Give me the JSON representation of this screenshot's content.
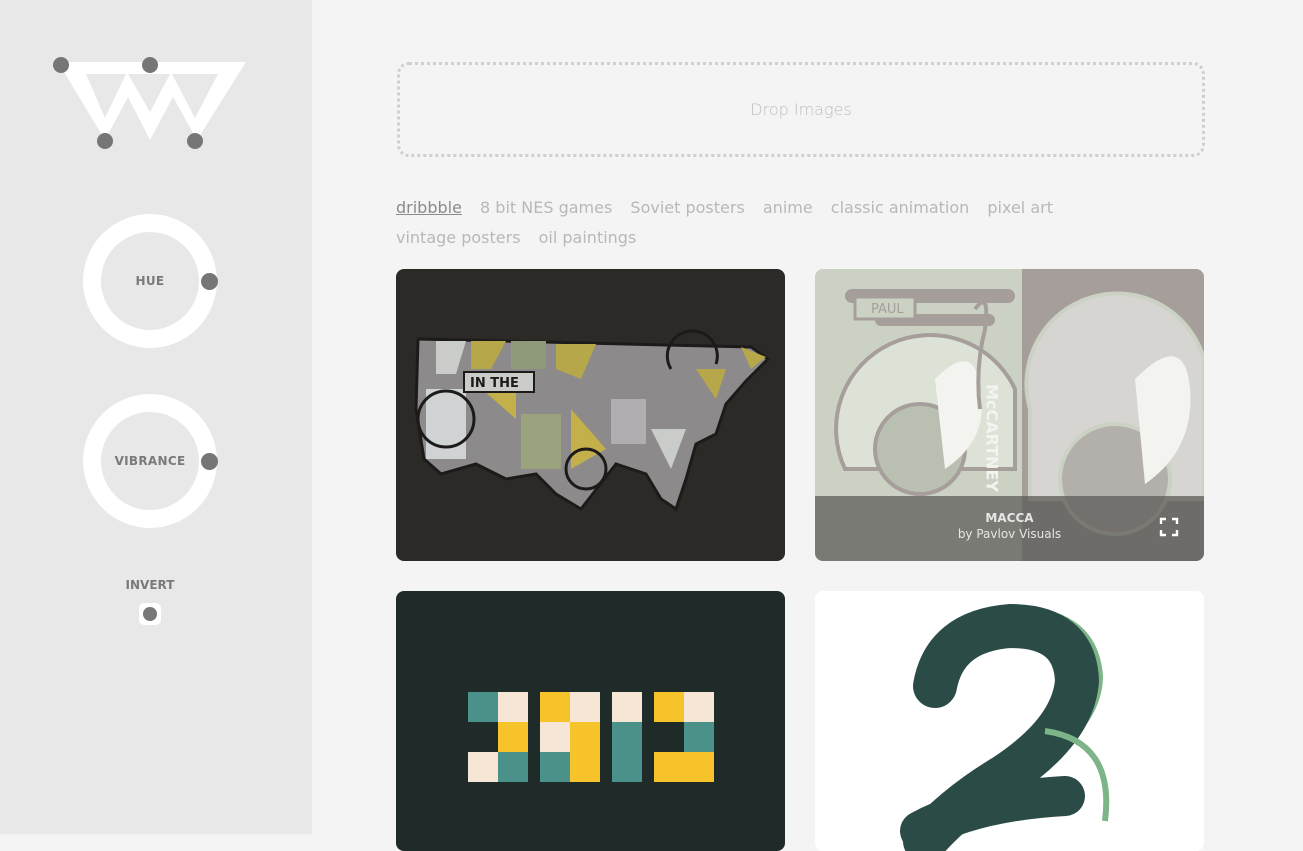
{
  "sidebar": {
    "logo": "logo-icon",
    "hue_label": "HUE",
    "vibrance_label": "VIBRANCE",
    "invert_label": "INVERT"
  },
  "dropzone": {
    "label": "Drop Images"
  },
  "tags": [
    "dribbble",
    "8 bit NES games",
    "Soviet posters",
    "anime",
    "classic animation",
    "pixel art",
    "vintage posters",
    "oil paintings"
  ],
  "active_tag": "dribbble",
  "gallery": {
    "items": [
      {
        "art": "usa-map-artwork"
      },
      {
        "art": "paul-mccartney-artwork",
        "title": "MACCA",
        "author": "by Pavlov Visuals"
      },
      {
        "art": "2017-artwork"
      },
      {
        "art": "number-2-brush-artwork"
      }
    ]
  },
  "colors": {
    "sidebar_bg": "#e8e8e8",
    "main_bg": "#f4f4f4",
    "knob_ring": "#ffffff",
    "handle": "#767676"
  }
}
